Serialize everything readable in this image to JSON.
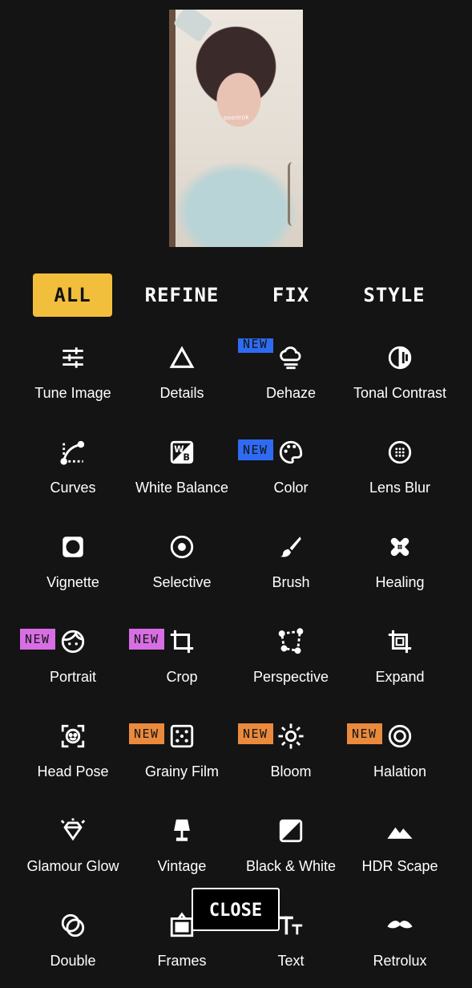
{
  "photo": {
    "watermark": "soonrok"
  },
  "tabs": [
    {
      "label": "ALL",
      "active": true
    },
    {
      "label": "REFINE",
      "active": false
    },
    {
      "label": "FIX",
      "active": false
    },
    {
      "label": "STYLE",
      "active": false
    }
  ],
  "badge_text": "NEW",
  "badge_colors": {
    "blue": "#2f6bf2",
    "purple": "#d86ee3",
    "orange": "#ea8a3c"
  },
  "accent": "#f2bf3c",
  "tools": [
    {
      "label": "Tune Image",
      "icon": "sliders-icon",
      "badge": null
    },
    {
      "label": "Details",
      "icon": "triangle-icon",
      "badge": null
    },
    {
      "label": "Dehaze",
      "icon": "cloud-haze-icon",
      "badge": "blue"
    },
    {
      "label": "Tonal Contrast",
      "icon": "tonal-contrast-icon",
      "badge": null
    },
    {
      "label": "Curves",
      "icon": "curves-icon",
      "badge": null
    },
    {
      "label": "White Balance",
      "icon": "white-balance-icon",
      "badge": null
    },
    {
      "label": "Color",
      "icon": "palette-icon",
      "badge": "blue"
    },
    {
      "label": "Lens Blur",
      "icon": "lens-blur-icon",
      "badge": null
    },
    {
      "label": "Vignette",
      "icon": "vignette-icon",
      "badge": null
    },
    {
      "label": "Selective",
      "icon": "selective-icon",
      "badge": null
    },
    {
      "label": "Brush",
      "icon": "brush-icon",
      "badge": null
    },
    {
      "label": "Healing",
      "icon": "bandage-icon",
      "badge": null
    },
    {
      "label": "Portrait",
      "icon": "face-icon",
      "badge": "purple"
    },
    {
      "label": "Crop",
      "icon": "crop-icon",
      "badge": "purple"
    },
    {
      "label": "Perspective",
      "icon": "perspective-icon",
      "badge": null
    },
    {
      "label": "Expand",
      "icon": "expand-icon",
      "badge": null
    },
    {
      "label": "Head Pose",
      "icon": "head-pose-icon",
      "badge": null
    },
    {
      "label": "Grainy Film",
      "icon": "dice-icon",
      "badge": "orange"
    },
    {
      "label": "Bloom",
      "icon": "sun-icon",
      "badge": "orange"
    },
    {
      "label": "Halation",
      "icon": "halation-icon",
      "badge": "orange"
    },
    {
      "label": "Glamour Glow",
      "icon": "diamond-icon",
      "badge": null
    },
    {
      "label": "Vintage",
      "icon": "lamp-icon",
      "badge": null
    },
    {
      "label": "Black & White",
      "icon": "bw-icon",
      "badge": null
    },
    {
      "label": "HDR Scape",
      "icon": "mountains-icon",
      "badge": null
    },
    {
      "label": "Double",
      "icon": "double-exposure-icon",
      "badge": null
    },
    {
      "label": "Frames",
      "icon": "frames-icon",
      "badge": null
    },
    {
      "label": "Text",
      "icon": "text-icon",
      "badge": null
    },
    {
      "label": "Retrolux",
      "icon": "mustache-icon",
      "badge": null
    }
  ],
  "close_label": "CLOSE"
}
